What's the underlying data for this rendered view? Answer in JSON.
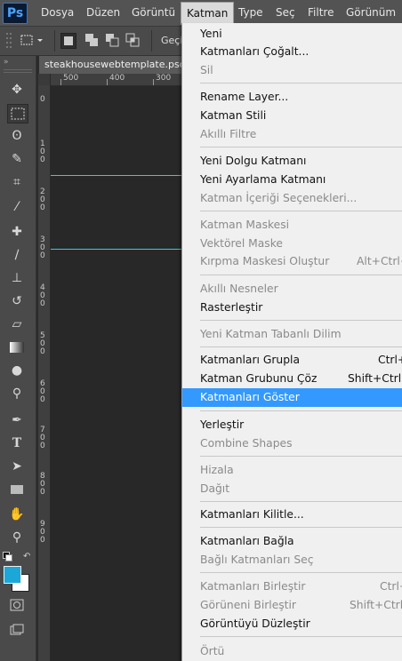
{
  "menubar": {
    "logo": "Ps",
    "items": [
      "Dosya",
      "Düzen",
      "Görüntü",
      "Katman",
      "Type",
      "Seç",
      "Filtre",
      "Görünüm"
    ]
  },
  "options_bar": {
    "partial_text": "Geçi"
  },
  "document": {
    "tab": "steakhousewebtemplate.psd",
    "ruler_h": [
      "500",
      "400",
      "300"
    ],
    "ruler_v": [
      "0",
      "1\n0\n0",
      "2\n0\n0",
      "3\n0\n0",
      "4\n0\n0",
      "5\n0\n0",
      "6\n0\n0",
      "7\n0\n0",
      "8\n0\n0",
      "9\n0\n0"
    ]
  },
  "colors": {
    "guide": "#22d3e6",
    "foreground": "#1ba8d8",
    "background": "#ffffff",
    "highlight": "#3399ff"
  },
  "menu": {
    "items": [
      {
        "label": "Yeni",
        "state": "normal"
      },
      {
        "label": "Katmanları Çoğalt...",
        "state": "normal"
      },
      {
        "label": "Sil",
        "state": "disabled"
      },
      {
        "label": "Rename Layer...",
        "state": "normal"
      },
      {
        "label": "Katman Stili",
        "state": "normal"
      },
      {
        "label": "Akıllı Filtre",
        "state": "disabled"
      },
      {
        "label": "Yeni Dolgu Katmanı",
        "state": "normal"
      },
      {
        "label": "Yeni Ayarlama Katmanı",
        "state": "normal"
      },
      {
        "label": "Katman İçeriği Seçenekleri...",
        "state": "disabled"
      },
      {
        "label": "Katman Maskesi",
        "state": "disabled"
      },
      {
        "label": "Vektörel Maske",
        "state": "disabled"
      },
      {
        "label": "Kırpma Maskesi Oluştur",
        "state": "disabled",
        "shortcut": "Alt+Ctrl+"
      },
      {
        "label": "Akıllı Nesneler",
        "state": "disabled"
      },
      {
        "label": "Rasterleştir",
        "state": "normal"
      },
      {
        "label": "Yeni Katman Tabanlı Dilim",
        "state": "disabled"
      },
      {
        "label": "Katmanları Grupla",
        "state": "normal",
        "shortcut": "Ctrl+"
      },
      {
        "label": "Katman Grubunu Çöz",
        "state": "normal",
        "shortcut": "Shift+Ctrl+"
      },
      {
        "label": "Katmanları Göster",
        "state": "highlighted"
      },
      {
        "label": "Yerleştir",
        "state": "normal"
      },
      {
        "label": "Combine Shapes",
        "state": "disabled"
      },
      {
        "label": "Hizala",
        "state": "disabled"
      },
      {
        "label": "Dağıt",
        "state": "disabled"
      },
      {
        "label": "Katmanları Kilitle...",
        "state": "normal"
      },
      {
        "label": "Katmanları Bağla",
        "state": "normal"
      },
      {
        "label": "Bağlı Katmanları Seç",
        "state": "disabled"
      },
      {
        "label": "Katmanları Birleştir",
        "state": "disabled",
        "shortcut": "Ctrl+"
      },
      {
        "label": "Görüneni Birleştir",
        "state": "disabled",
        "shortcut": "Shift+Ctrl+"
      },
      {
        "label": "Görüntüyü Düzleştir",
        "state": "normal"
      },
      {
        "label": "Örtü",
        "state": "disabled"
      }
    ]
  }
}
